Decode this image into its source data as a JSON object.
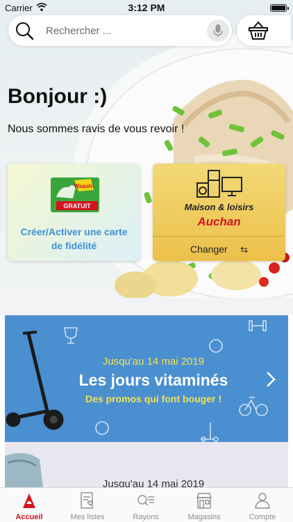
{
  "status_bar": {
    "carrier": "Carrier",
    "time": "3:12 PM"
  },
  "search": {
    "placeholder": "Rechercher ...",
    "value": ""
  },
  "header": {
    "greeting": "Bonjour :)",
    "subtitle": "Nous sommes ravis de vous revoir !"
  },
  "loyalty_card": {
    "badge": "GRATUIT",
    "logo_text": "Waaoh!",
    "label": "Créer/Activer une carte de fidélité"
  },
  "store_card": {
    "store_name": "Maison & loisirs",
    "brand": "Auchan",
    "change_label": "Changer"
  },
  "promo": {
    "date": "Jusqu'au 14 mai 2019",
    "title": "Les jours vitaminés",
    "subtitle": "Des promos qui font bouger !"
  },
  "promo2": {
    "date": "Jusqu'au 14 mai 2019"
  },
  "tabs": [
    {
      "label": "Accueil",
      "icon": "home-icon",
      "active": true
    },
    {
      "label": "Mes listes",
      "icon": "lists-icon",
      "active": false
    },
    {
      "label": "Rayons",
      "icon": "departments-icon",
      "active": false
    },
    {
      "label": "Magasins",
      "icon": "store-icon",
      "active": false
    },
    {
      "label": "Compte",
      "icon": "account-icon",
      "active": false
    }
  ],
  "colors": {
    "accent": "#d2141e",
    "link_blue": "#3a92d6",
    "promo_blue": "#4a8fd0",
    "promo_yellow": "#f5e24b",
    "store_gold": "#ecc04a"
  }
}
